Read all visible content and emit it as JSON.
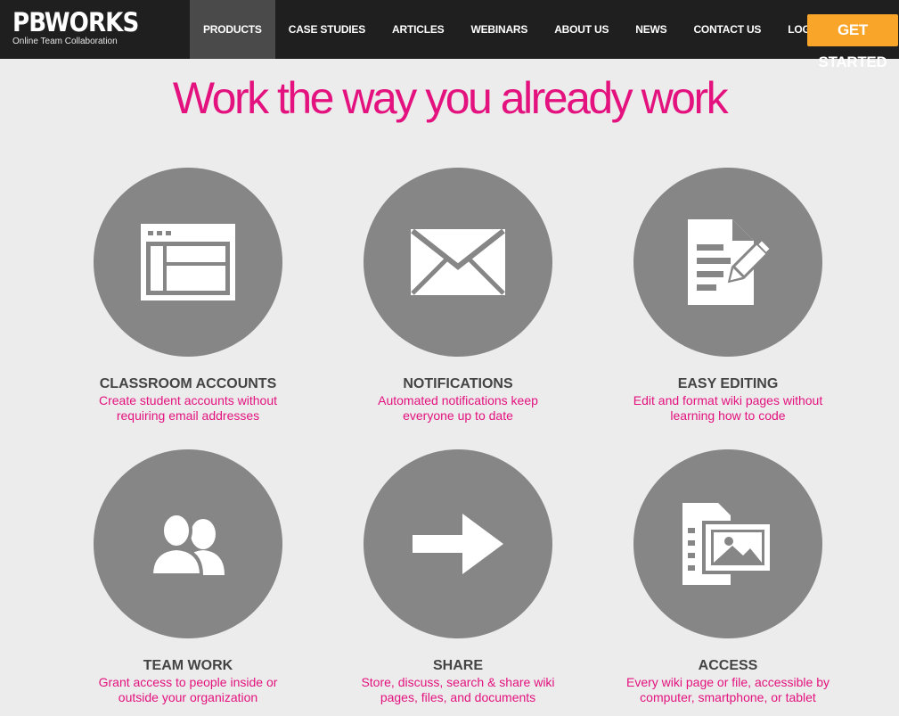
{
  "header": {
    "logo_word": "PBWORKS",
    "logo_tagline": "Online Team Collaboration",
    "nav": [
      "PRODUCTS",
      "CASE STUDIES",
      "ARTICLES",
      "WEBINARS",
      "ABOUT US",
      "NEWS",
      "CONTACT US",
      "LOGIN"
    ],
    "active_nav": "PRODUCTS",
    "cta_label": "GET STARTED"
  },
  "hero": {
    "title": "Work the way you already work"
  },
  "features": [
    {
      "icon": "browser-window-icon",
      "title": "CLASSROOM ACCOUNTS",
      "desc": "Create student accounts without requiring email addresses"
    },
    {
      "icon": "envelope-icon",
      "title": "NOTIFICATIONS",
      "desc": "Automated notifications keep everyone up to date"
    },
    {
      "icon": "document-pencil-icon",
      "title": "EASY EDITING",
      "desc": "Edit and format wiki pages without learning how to code"
    },
    {
      "icon": "people-icon",
      "title": "TEAM WORK",
      "desc": "Grant access to people inside or outside your organization"
    },
    {
      "icon": "arrow-right-icon",
      "title": "SHARE",
      "desc": "Store, discuss, search & share wiki pages, files, and documents"
    },
    {
      "icon": "media-files-icon",
      "title": "ACCESS",
      "desc": "Every wiki page or file, accessible by computer, smartphone, or tablet"
    }
  ],
  "colors": {
    "accent": "#e3127e",
    "cta": "#f8a52a",
    "header_bg": "#1f1f1f",
    "circle": "#868686",
    "page_bg": "#ececec"
  }
}
